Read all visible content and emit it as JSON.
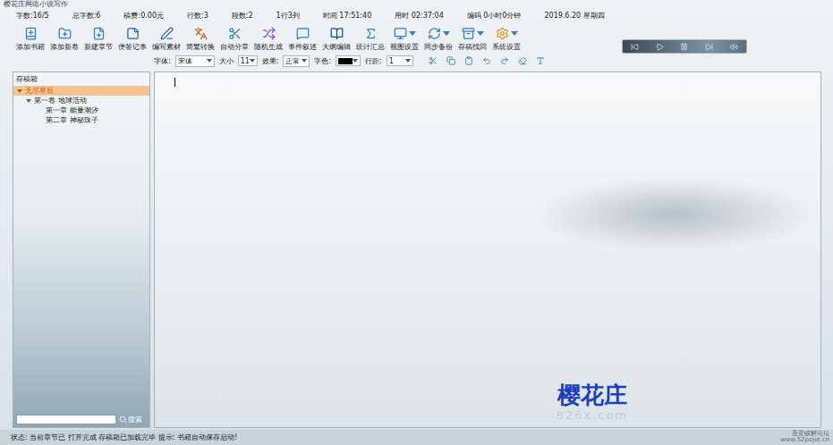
{
  "window": {
    "title": "樱花庄网络小说写作"
  },
  "info_bar": [
    "字数:16/5",
    "总字数:6",
    "稿费:0.00元",
    "行数:3",
    "段数:2",
    "1行3列",
    "时间 17:51:40",
    "用时 02:37:04",
    "编码 0小时0分钟",
    "2019.6.20 星期四"
  ],
  "toolbar": [
    {
      "label": "添加书籍",
      "dropdown": false
    },
    {
      "label": "添加新卷",
      "dropdown": false
    },
    {
      "label": "新建章节",
      "dropdown": false
    },
    {
      "label": "便签记事",
      "dropdown": false
    },
    {
      "label": "编写素材",
      "dropdown": false
    },
    {
      "label": "简繁转换",
      "dropdown": false
    },
    {
      "label": "自动分章",
      "dropdown": false
    },
    {
      "label": "随机生成",
      "dropdown": false
    },
    {
      "label": "事件叙述",
      "dropdown": false
    },
    {
      "label": "大纲编辑",
      "dropdown": false
    },
    {
      "label": "统计汇总",
      "dropdown": false
    },
    {
      "label": "视图设置",
      "dropdown": true
    },
    {
      "label": "同步备份",
      "dropdown": true
    },
    {
      "label": "存稿找回",
      "dropdown": true
    },
    {
      "label": "系统设置",
      "dropdown": true
    }
  ],
  "format_bar": {
    "font_label": "字体:",
    "font": "宋体",
    "size_label": "大小",
    "size": "11",
    "effect_label": "效果:",
    "effect": "正常",
    "color_label": "字色:",
    "color": "#000000",
    "spacing_label": "行距:",
    "spacing": "1"
  },
  "sidebar": {
    "title": "存稿箱",
    "tree": [
      {
        "label": "无尽星辰",
        "kind": "book",
        "expanded": true,
        "selected": true
      },
      {
        "label": "第一卷 地球活动",
        "kind": "volume",
        "expanded": true,
        "selected": false
      },
      {
        "label": "第一章 能量潮汐",
        "kind": "chapter",
        "expanded": false,
        "selected": false
      },
      {
        "label": "第二章 神秘珠子",
        "kind": "chapter",
        "expanded": false,
        "selected": false
      }
    ],
    "search": {
      "placeholder": "",
      "button": "搜索"
    }
  },
  "watermark": {
    "title": "樱花庄",
    "url": "826x.com"
  },
  "status_bar": {
    "text": "状态: 当前章节已 打开完成 存稿箱已加载完毕  提示: 书籍自动保存启动!"
  },
  "site_mark": [
    "吾爱破解论坛",
    "www.52pojie.cn"
  ]
}
